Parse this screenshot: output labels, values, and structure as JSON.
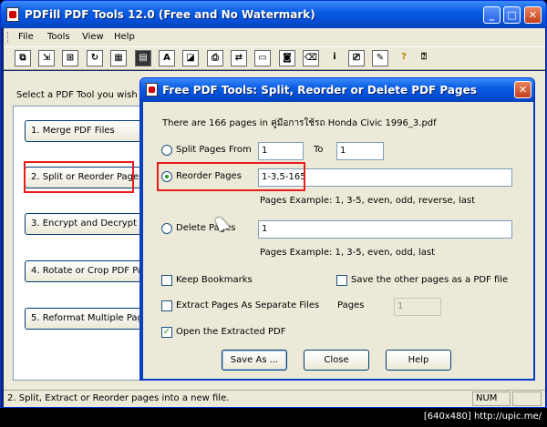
{
  "window": {
    "title": "PDFill PDF Tools 12.0 (Free and No Watermark)",
    "minimize": "_",
    "maximize": "□",
    "close": "✕"
  },
  "menu": {
    "items": [
      {
        "label": "File"
      },
      {
        "label": "Tools"
      },
      {
        "label": "View"
      },
      {
        "label": "Help"
      }
    ]
  },
  "toolbar": {
    "buttons": [
      {
        "icon": "merge-icon",
        "glyph": "⧉"
      },
      {
        "icon": "split-icon",
        "glyph": "⇲"
      },
      {
        "icon": "encrypt-icon",
        "glyph": "⊞"
      },
      {
        "icon": "rotate-icon",
        "glyph": "↻"
      },
      {
        "icon": "grid-icon",
        "glyph": "▦"
      },
      {
        "icon": "film-icon",
        "glyph": "▤"
      },
      {
        "icon": "text-icon",
        "glyph": "A"
      },
      {
        "icon": "image-icon",
        "glyph": "◪"
      },
      {
        "icon": "stamp-icon",
        "glyph": "⎙"
      },
      {
        "icon": "convert-icon",
        "glyph": "⇄"
      },
      {
        "icon": "header-icon",
        "glyph": "▭"
      },
      {
        "icon": "form-icon",
        "glyph": "◙"
      },
      {
        "icon": "delete-icon",
        "glyph": "⌫"
      },
      {
        "icon": "info-icon",
        "glyph": "i"
      },
      {
        "icon": "print-icon",
        "glyph": "⎚"
      },
      {
        "icon": "pen-icon",
        "glyph": "✎"
      },
      {
        "icon": "help-icon",
        "glyph": "?"
      },
      {
        "icon": "whats-this-icon",
        "glyph": "⍰"
      }
    ]
  },
  "main": {
    "hint": "Select a PDF Tool you wish to c",
    "tools": [
      {
        "label": "1. Merge PDF Files"
      },
      {
        "label": "2. Split or Reorder Pages"
      },
      {
        "label": "3. Encrypt and Decrypt Op"
      },
      {
        "label": "4. Rotate or Crop PDF Pag"
      },
      {
        "label": "5. Reformat Multiple Page"
      }
    ]
  },
  "statusbar": {
    "text": "2. Split, Extract or Reorder pages into a new file.",
    "num": "NUM"
  },
  "dialog": {
    "title": "Free PDF Tools: Split, Reorder or Delete PDF Pages",
    "close": "✕",
    "info": "There are 166 pages in คู่มือการใช้รถ Honda Civic 1996_3.pdf",
    "split": {
      "label": "Split Pages From",
      "from": "1",
      "to_label": "To",
      "to": "1"
    },
    "reorder": {
      "label": "Reorder Pages",
      "value": "1-3,5-165",
      "example": "Pages Example: 1, 3-5, even, odd, reverse, last"
    },
    "delete": {
      "label": "Delete Pages",
      "value": "1",
      "example": "Pages Example: 1, 3-5, even, odd, last"
    },
    "keep_bookmarks": "Keep Bookmarks",
    "save_other": "Save the other pages as a PDF file",
    "extract_separate": "Extract Pages As Separate Files",
    "pages_label": "Pages",
    "pages_value": "1",
    "open_extracted": "Open the Extracted PDF",
    "buttons": {
      "save_as": "Save As ...",
      "close": "Close",
      "help": "Help"
    }
  },
  "caption": "[640x480] http://upic.me/"
}
